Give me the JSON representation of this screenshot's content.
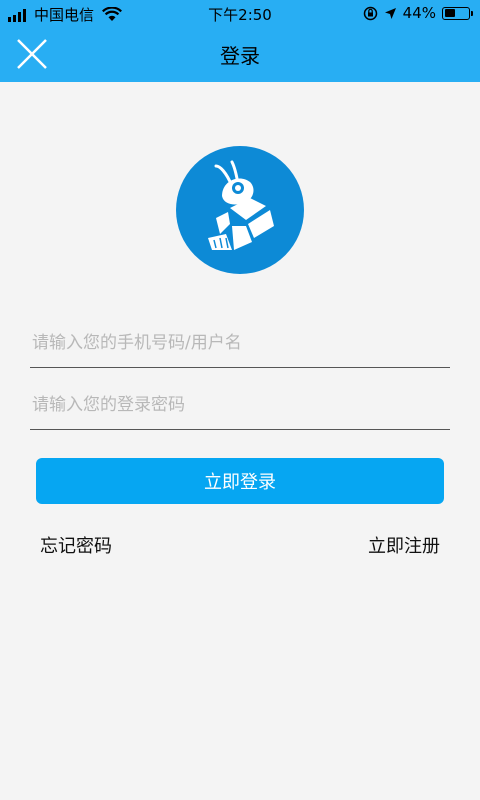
{
  "status_bar": {
    "carrier": "中国电信",
    "time": "下午2:50",
    "battery_percent": "44%",
    "battery_level": 0.44
  },
  "nav": {
    "title": "登录",
    "close_icon": "close-x-icon"
  },
  "logo": {
    "icon": "shrimp-logo-icon",
    "color": "#0d8ad6"
  },
  "form": {
    "username_placeholder": "请输入您的手机号码/用户名",
    "username_value": "",
    "password_placeholder": "请输入您的登录密码",
    "password_value": ""
  },
  "actions": {
    "login_label": "立即登录",
    "forgot_label": "忘记密码",
    "register_label": "立即注册"
  },
  "colors": {
    "header": "#28aef3",
    "button": "#06a6f2",
    "background": "#f4f4f4"
  }
}
